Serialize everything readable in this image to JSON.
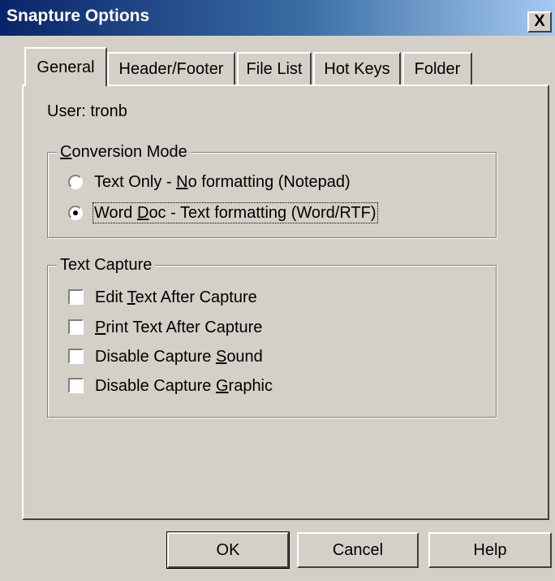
{
  "window": {
    "title": "Snapture Options",
    "close_label": "X"
  },
  "tabs": [
    {
      "label": "General",
      "active": true
    },
    {
      "label": "Header/Footer",
      "active": false
    },
    {
      "label": "File List",
      "active": false
    },
    {
      "label": "Hot Keys",
      "active": false
    },
    {
      "label": "Folder",
      "active": false
    }
  ],
  "user": {
    "prefix": "User: ",
    "name": "tronb"
  },
  "conversion_mode": {
    "title_mnemonic": "C",
    "title_rest": "onversion Mode",
    "options": [
      {
        "pre": "Text Only - ",
        "mnemonic": "N",
        "post": "o formatting (Notepad)",
        "checked": false
      },
      {
        "pre": "Word ",
        "mnemonic": "D",
        "post": "oc - Text formatting (Word/RTF)",
        "checked": true
      }
    ]
  },
  "text_capture": {
    "title": "Text Capture",
    "options": [
      {
        "pre": "Edit ",
        "mnemonic": "T",
        "post": "ext After Capture",
        "checked": false
      },
      {
        "pre": "",
        "mnemonic": "P",
        "post": "rint Text After Capture",
        "checked": false
      },
      {
        "pre": "Disable Capture ",
        "mnemonic": "S",
        "post": "ound",
        "checked": false
      },
      {
        "pre": "Disable Capture ",
        "mnemonic": "G",
        "post": "raphic",
        "checked": false
      }
    ]
  },
  "buttons": {
    "ok": "OK",
    "cancel": "Cancel",
    "help": "Help"
  }
}
